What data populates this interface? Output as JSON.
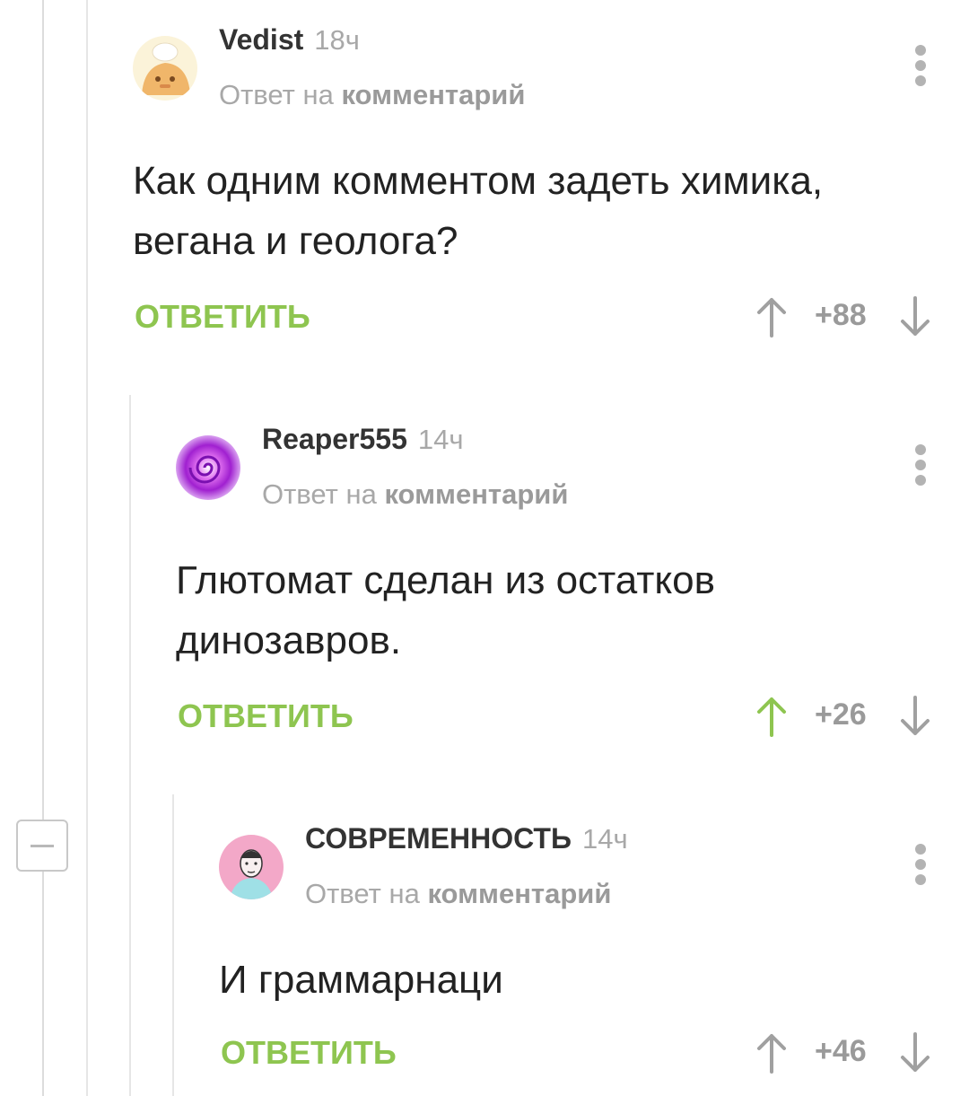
{
  "thread": {
    "collapse_icon": "minus-icon"
  },
  "comments": [
    {
      "author": "Vedist",
      "time": "18ч",
      "reply_prefix": "Ответ на",
      "reply_link": "комментарий",
      "text": "Как одним комментом задеть химика, вегана и геолога?",
      "reply_label": "ОТВЕТИТЬ",
      "score": "+88",
      "upvoted": false
    },
    {
      "author": "Reaper555",
      "time": "14ч",
      "reply_prefix": "Ответ на",
      "reply_link": "комментарий",
      "text": "Глютомат сделан из остатков динозавров.",
      "reply_label": "ОТВЕТИТЬ",
      "score": "+26",
      "upvoted": true
    },
    {
      "author": "СОВРЕМЕННОСТЬ",
      "time": "14ч",
      "reply_prefix": "Ответ на",
      "reply_link": "комментарий",
      "text": "И граммарнаци",
      "reply_label": "ОТВЕТИТЬ",
      "score": "+46",
      "upvoted": false
    }
  ],
  "colors": {
    "accent_green": "#8ec550",
    "vote_gray": "#a0a0a0",
    "text": "#222222",
    "muted": "#a8a8a8"
  }
}
